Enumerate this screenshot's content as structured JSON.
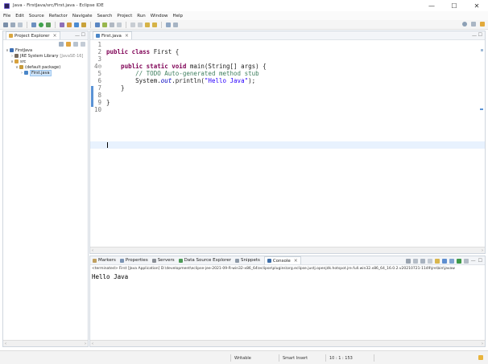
{
  "window": {
    "title": "Java - FirstJava/src/First.java - Eclipse IDE",
    "minimize": "—",
    "maximize": "☐",
    "close": "✕"
  },
  "menu": [
    "File",
    "Edit",
    "Source",
    "Refactor",
    "Navigate",
    "Search",
    "Project",
    "Run",
    "Window",
    "Help"
  ],
  "explorer": {
    "tab_label": "Project Explorer",
    "tree": {
      "project": "FirstJava",
      "jre_label": "JRE System Library",
      "jre_detail": "[JavaSE-16]",
      "src": "src",
      "package": "(default package)",
      "file": "First.java"
    }
  },
  "editor": {
    "tab_label": "First.java",
    "lines": [
      {
        "n": "1",
        "tokens": []
      },
      {
        "n": "2",
        "tokens": [
          {
            "t": "public class ",
            "c": "kw"
          },
          {
            "t": "First {",
            "c": ""
          }
        ]
      },
      {
        "n": "3",
        "tokens": []
      },
      {
        "n": "4⊝",
        "tokens": [
          {
            "t": "    public static void ",
            "c": "kw"
          },
          {
            "t": "main(String[] args) {",
            "c": ""
          }
        ]
      },
      {
        "n": "5",
        "tokens": [
          {
            "t": "        // TODO Auto-generated method stub",
            "c": "cm"
          }
        ]
      },
      {
        "n": "6",
        "tokens": [
          {
            "t": "        System.",
            "c": ""
          },
          {
            "t": "out",
            "c": "fld"
          },
          {
            "t": ".println(",
            "c": ""
          },
          {
            "t": "\"Hello Java\"",
            "c": "str"
          },
          {
            "t": ");",
            "c": ""
          }
        ]
      },
      {
        "n": "7",
        "tokens": [
          {
            "t": "    }",
            "c": ""
          }
        ]
      },
      {
        "n": "8",
        "tokens": []
      },
      {
        "n": "9",
        "tokens": [
          {
            "t": "}",
            "c": ""
          }
        ]
      },
      {
        "n": "10",
        "tokens": []
      }
    ]
  },
  "console": {
    "tabs": [
      "Markers",
      "Properties",
      "Servers",
      "Data Source Explorer",
      "Snippets",
      "Console"
    ],
    "status": "<terminated> First [Java Application] D:\\development\\eclipse-jee-2021-09-R-win32-x86_64\\eclipse\\plugins\\org.eclipse.justj.openjdk.hotspot.jre.full.win32.x86_64_16.0.2.v20210721-1149\\jre\\bin\\javaw",
    "output": "Hello Java"
  },
  "statusbar": {
    "writable": "Writable",
    "insert_mode": "Smart Insert",
    "position": "10 : 1 : 153"
  }
}
